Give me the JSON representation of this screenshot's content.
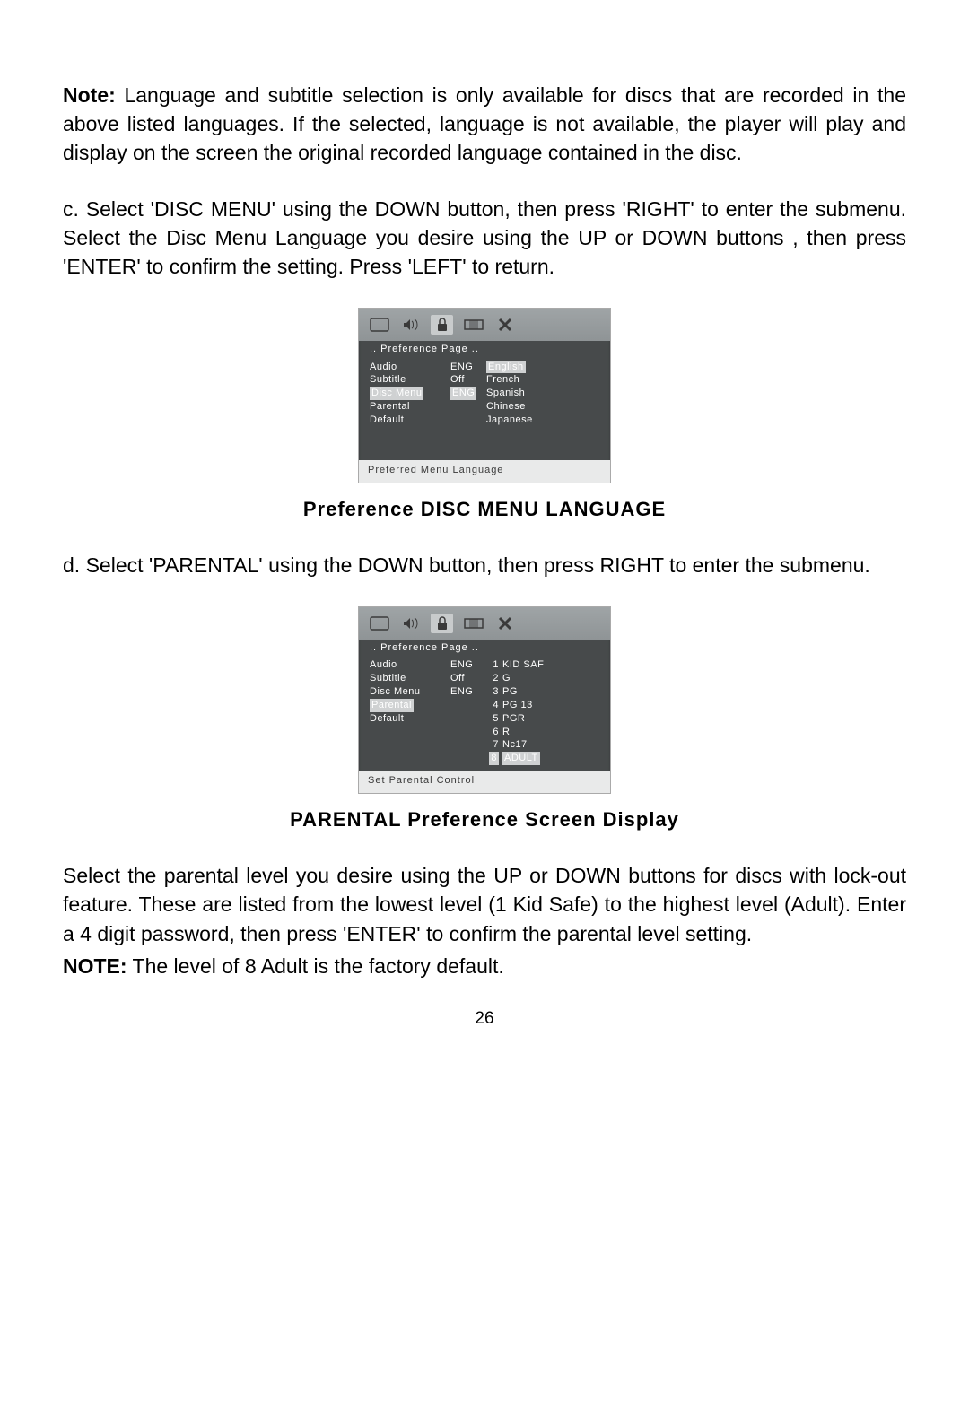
{
  "note_para": {
    "bold": "Note:",
    "rest": " Language and subtitle selection is only available for discs that are recorded in  the above listed languages.  If the selected, language is not available,  the player will play and display on the screen the original recorded language contained in the disc."
  },
  "step_c": "c. Select 'DISC MENU' using the DOWN button, then press 'RIGHT' to enter the submenu. Select the Disc Menu Language you desire using the UP or DOWN buttons , then press 'ENTER' to confirm the setting. Press 'LEFT' to return.",
  "screenshot1": {
    "title": "..  Preference  Page  ..",
    "labels": [
      "Audio",
      "Subtitle",
      "Disc  Menu",
      "Parental",
      "Default"
    ],
    "vals": [
      "ENG",
      "Off",
      "ENG",
      "",
      ""
    ],
    "options": [
      "English",
      "French",
      "Spanish",
      "Chinese",
      "Japanese"
    ],
    "highlight_label_idx": 2,
    "highlight_option_idx": 0,
    "footer": "Preferred  Menu  Language"
  },
  "caption1": "Preference DISC MENU LANGUAGE",
  "step_d": "d. Select 'PARENTAL' using the DOWN button, then press RIGHT to enter the submenu.",
  "screenshot2": {
    "title": "..  Preference  Page  ..",
    "labels": [
      "Audio",
      "Subtitle",
      "Disc  Menu",
      "Parental",
      "Default"
    ],
    "vals": [
      "ENG",
      "Off",
      "ENG",
      "",
      ""
    ],
    "nums": [
      "1",
      "2",
      "3",
      "4",
      "5",
      "6",
      "7",
      "8"
    ],
    "options": [
      "KID  SAF",
      "G",
      "PG",
      "PG  13",
      "PGR",
      "R",
      "Nc17",
      "ADULT"
    ],
    "highlight_label_idx": 3,
    "highlight_option_idx": 7,
    "footer": "Set  Parental  Control"
  },
  "caption2": "PARENTAL Preference Screen Display",
  "parental_para": "Select the parental level you desire using the UP or DOWN buttons for discs with lock-out  feature. These are listed from the lowest level (1 Kid Safe) to the highest level (Adult). Enter a 4 digit password, then press 'ENTER' to confirm the parental level setting.",
  "note2": {
    "bold": "NOTE:",
    "rest": " The level of 8 Adult is the factory default."
  },
  "page_number": "26"
}
